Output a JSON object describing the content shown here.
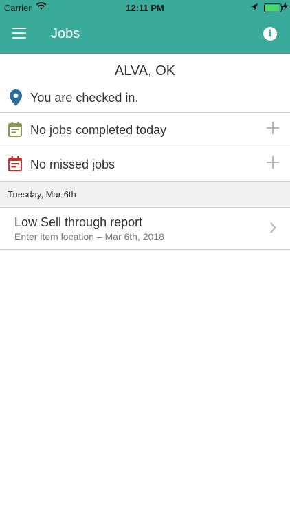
{
  "status_bar": {
    "carrier": "Carrier",
    "time": "12:11 PM",
    "battery_level": 1.0
  },
  "app_bar": {
    "title": "Jobs",
    "info_label": "i"
  },
  "store": {
    "name": "ALVA, OK"
  },
  "checkin": {
    "text": "You are checked in."
  },
  "summary_rows": [
    {
      "label": "No jobs completed today",
      "icon": "calendar-completed-icon",
      "color": "#8a9a4b"
    },
    {
      "label": "No missed jobs",
      "icon": "calendar-missed-icon",
      "color": "#d0312d"
    }
  ],
  "section": {
    "date": "Tuesday, Mar 6th"
  },
  "jobs": [
    {
      "title": "Low Sell through report",
      "subtitle": "Enter item location – Mar 6th, 2018"
    }
  ],
  "colors": {
    "accent": "#3aaa9a",
    "pin": "#2a6f9b",
    "divider": "#cfcfcf"
  }
}
